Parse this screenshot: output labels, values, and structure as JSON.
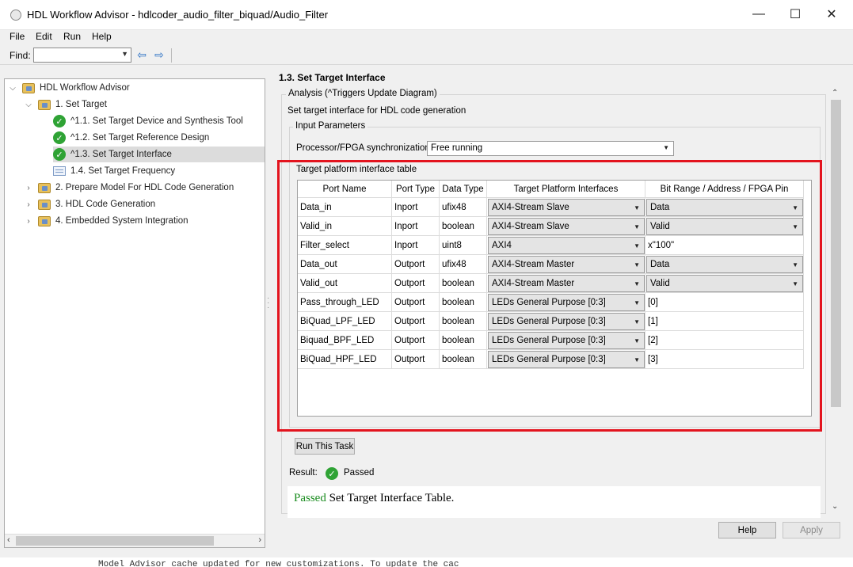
{
  "window": {
    "title": "HDL Workflow Advisor - hdlcoder_audio_filter_biquad/Audio_Filter",
    "minimize_glyph": "—",
    "maximize_glyph": "☐",
    "close_glyph": "✕"
  },
  "menu": [
    "File",
    "Edit",
    "Run",
    "Help"
  ],
  "toolbar": {
    "find_label": "Find:",
    "find_value": "",
    "back_icon": "arrow-left-icon",
    "forward_icon": "arrow-right-icon"
  },
  "tree": {
    "items": [
      {
        "label": "HDL Workflow Advisor",
        "icon": "folder-icon",
        "expanded": true,
        "level": 0
      },
      {
        "label": "1. Set Target",
        "icon": "folder-icon",
        "expanded": true,
        "level": 1
      },
      {
        "label": "^1.1. Set Target Device and Synthesis Tool",
        "icon": "check-icon",
        "level": 2
      },
      {
        "label": "^1.2. Set Target Reference Design",
        "icon": "check-icon",
        "level": 2
      },
      {
        "label": "^1.3. Set Target Interface",
        "icon": "check-icon",
        "level": 2,
        "selected": true
      },
      {
        "label": "1.4. Set Target Frequency",
        "icon": "list-icon",
        "level": 2
      },
      {
        "label": "2. Prepare Model For HDL Code Generation",
        "icon": "folder-icon",
        "expanded": false,
        "level": 1
      },
      {
        "label": "3. HDL Code Generation",
        "icon": "folder-icon",
        "expanded": false,
        "level": 1
      },
      {
        "label": "4. Embedded System Integration",
        "icon": "folder-icon",
        "expanded": false,
        "level": 1
      }
    ]
  },
  "task": {
    "title": "1.3. Set Target Interface",
    "analysis_label": "Analysis (^Triggers Update Diagram)",
    "description": "Set target interface for HDL code generation",
    "input_params_label": "Input Parameters",
    "sync_label": "Processor/FPGA synchronization:",
    "sync_value": "Free running",
    "table_group_label": "Target platform interface table",
    "run_button": "Run This Task",
    "result_label": "Result:",
    "result_status": "Passed",
    "result_message_status": "Passed",
    "result_message_text": "Set Target Interface Table."
  },
  "table": {
    "columns": [
      "Port Name",
      "Port Type",
      "Data Type",
      "Target Platform Interfaces",
      "Bit Range / Address / FPGA Pin"
    ],
    "rows": [
      {
        "port": "Data_in",
        "type": "Inport",
        "dtype": "ufix48",
        "iface": "AXI4-Stream Slave",
        "bits": "Data",
        "bits_dropdown": true
      },
      {
        "port": "Valid_in",
        "type": "Inport",
        "dtype": "boolean",
        "iface": "AXI4-Stream Slave",
        "bits": "Valid",
        "bits_dropdown": true
      },
      {
        "port": "Filter_select",
        "type": "Inport",
        "dtype": "uint8",
        "iface": "AXI4",
        "bits": "x\"100\"",
        "bits_dropdown": false
      },
      {
        "port": "Data_out",
        "type": "Outport",
        "dtype": "ufix48",
        "iface": "AXI4-Stream Master",
        "bits": "Data",
        "bits_dropdown": true
      },
      {
        "port": "Valid_out",
        "type": "Outport",
        "dtype": "boolean",
        "iface": "AXI4-Stream Master",
        "bits": "Valid",
        "bits_dropdown": true
      },
      {
        "port": "Pass_through_LED",
        "type": "Outport",
        "dtype": "boolean",
        "iface": "LEDs General Purpose [0:3]",
        "bits": "[0]",
        "bits_dropdown": false
      },
      {
        "port": "BiQuad_LPF_LED",
        "type": "Outport",
        "dtype": "boolean",
        "iface": "LEDs General Purpose [0:3]",
        "bits": "[1]",
        "bits_dropdown": false
      },
      {
        "port": "Biquad_BPF_LED",
        "type": "Outport",
        "dtype": "boolean",
        "iface": "LEDs General Purpose [0:3]",
        "bits": "[2]",
        "bits_dropdown": false
      },
      {
        "port": "BiQuad_HPF_LED",
        "type": "Outport",
        "dtype": "boolean",
        "iface": "LEDs General Purpose [0:3]",
        "bits": "[3]",
        "bits_dropdown": false
      }
    ]
  },
  "footer": {
    "help_button": "Help",
    "apply_button": "Apply"
  },
  "background_text": "Model Advisor cache updated  for new customizations. To update the cac",
  "colors": {
    "highlight_box": "#e3141e",
    "passed_green": "#2fa335",
    "selection": "#dcdcdc"
  }
}
